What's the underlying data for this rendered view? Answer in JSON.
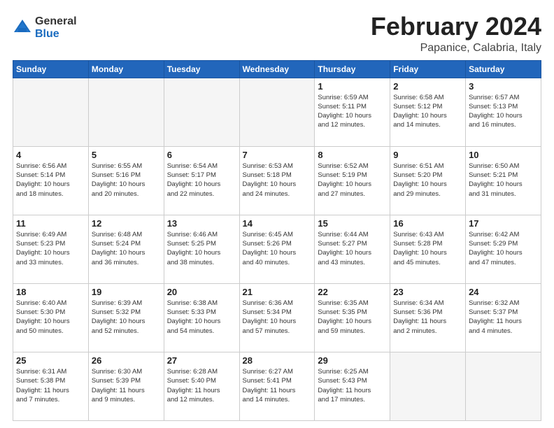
{
  "logo": {
    "general": "General",
    "blue": "Blue"
  },
  "header": {
    "month": "February 2024",
    "location": "Papanice, Calabria, Italy"
  },
  "weekdays": [
    "Sunday",
    "Monday",
    "Tuesday",
    "Wednesday",
    "Thursday",
    "Friday",
    "Saturday"
  ],
  "weeks": [
    [
      {
        "day": "",
        "info": ""
      },
      {
        "day": "",
        "info": ""
      },
      {
        "day": "",
        "info": ""
      },
      {
        "day": "",
        "info": ""
      },
      {
        "day": "1",
        "info": "Sunrise: 6:59 AM\nSunset: 5:11 PM\nDaylight: 10 hours\nand 12 minutes."
      },
      {
        "day": "2",
        "info": "Sunrise: 6:58 AM\nSunset: 5:12 PM\nDaylight: 10 hours\nand 14 minutes."
      },
      {
        "day": "3",
        "info": "Sunrise: 6:57 AM\nSunset: 5:13 PM\nDaylight: 10 hours\nand 16 minutes."
      }
    ],
    [
      {
        "day": "4",
        "info": "Sunrise: 6:56 AM\nSunset: 5:14 PM\nDaylight: 10 hours\nand 18 minutes."
      },
      {
        "day": "5",
        "info": "Sunrise: 6:55 AM\nSunset: 5:16 PM\nDaylight: 10 hours\nand 20 minutes."
      },
      {
        "day": "6",
        "info": "Sunrise: 6:54 AM\nSunset: 5:17 PM\nDaylight: 10 hours\nand 22 minutes."
      },
      {
        "day": "7",
        "info": "Sunrise: 6:53 AM\nSunset: 5:18 PM\nDaylight: 10 hours\nand 24 minutes."
      },
      {
        "day": "8",
        "info": "Sunrise: 6:52 AM\nSunset: 5:19 PM\nDaylight: 10 hours\nand 27 minutes."
      },
      {
        "day": "9",
        "info": "Sunrise: 6:51 AM\nSunset: 5:20 PM\nDaylight: 10 hours\nand 29 minutes."
      },
      {
        "day": "10",
        "info": "Sunrise: 6:50 AM\nSunset: 5:21 PM\nDaylight: 10 hours\nand 31 minutes."
      }
    ],
    [
      {
        "day": "11",
        "info": "Sunrise: 6:49 AM\nSunset: 5:23 PM\nDaylight: 10 hours\nand 33 minutes."
      },
      {
        "day": "12",
        "info": "Sunrise: 6:48 AM\nSunset: 5:24 PM\nDaylight: 10 hours\nand 36 minutes."
      },
      {
        "day": "13",
        "info": "Sunrise: 6:46 AM\nSunset: 5:25 PM\nDaylight: 10 hours\nand 38 minutes."
      },
      {
        "day": "14",
        "info": "Sunrise: 6:45 AM\nSunset: 5:26 PM\nDaylight: 10 hours\nand 40 minutes."
      },
      {
        "day": "15",
        "info": "Sunrise: 6:44 AM\nSunset: 5:27 PM\nDaylight: 10 hours\nand 43 minutes."
      },
      {
        "day": "16",
        "info": "Sunrise: 6:43 AM\nSunset: 5:28 PM\nDaylight: 10 hours\nand 45 minutes."
      },
      {
        "day": "17",
        "info": "Sunrise: 6:42 AM\nSunset: 5:29 PM\nDaylight: 10 hours\nand 47 minutes."
      }
    ],
    [
      {
        "day": "18",
        "info": "Sunrise: 6:40 AM\nSunset: 5:30 PM\nDaylight: 10 hours\nand 50 minutes."
      },
      {
        "day": "19",
        "info": "Sunrise: 6:39 AM\nSunset: 5:32 PM\nDaylight: 10 hours\nand 52 minutes."
      },
      {
        "day": "20",
        "info": "Sunrise: 6:38 AM\nSunset: 5:33 PM\nDaylight: 10 hours\nand 54 minutes."
      },
      {
        "day": "21",
        "info": "Sunrise: 6:36 AM\nSunset: 5:34 PM\nDaylight: 10 hours\nand 57 minutes."
      },
      {
        "day": "22",
        "info": "Sunrise: 6:35 AM\nSunset: 5:35 PM\nDaylight: 10 hours\nand 59 minutes."
      },
      {
        "day": "23",
        "info": "Sunrise: 6:34 AM\nSunset: 5:36 PM\nDaylight: 11 hours\nand 2 minutes."
      },
      {
        "day": "24",
        "info": "Sunrise: 6:32 AM\nSunset: 5:37 PM\nDaylight: 11 hours\nand 4 minutes."
      }
    ],
    [
      {
        "day": "25",
        "info": "Sunrise: 6:31 AM\nSunset: 5:38 PM\nDaylight: 11 hours\nand 7 minutes."
      },
      {
        "day": "26",
        "info": "Sunrise: 6:30 AM\nSunset: 5:39 PM\nDaylight: 11 hours\nand 9 minutes."
      },
      {
        "day": "27",
        "info": "Sunrise: 6:28 AM\nSunset: 5:40 PM\nDaylight: 11 hours\nand 12 minutes."
      },
      {
        "day": "28",
        "info": "Sunrise: 6:27 AM\nSunset: 5:41 PM\nDaylight: 11 hours\nand 14 minutes."
      },
      {
        "day": "29",
        "info": "Sunrise: 6:25 AM\nSunset: 5:43 PM\nDaylight: 11 hours\nand 17 minutes."
      },
      {
        "day": "",
        "info": ""
      },
      {
        "day": "",
        "info": ""
      }
    ]
  ]
}
